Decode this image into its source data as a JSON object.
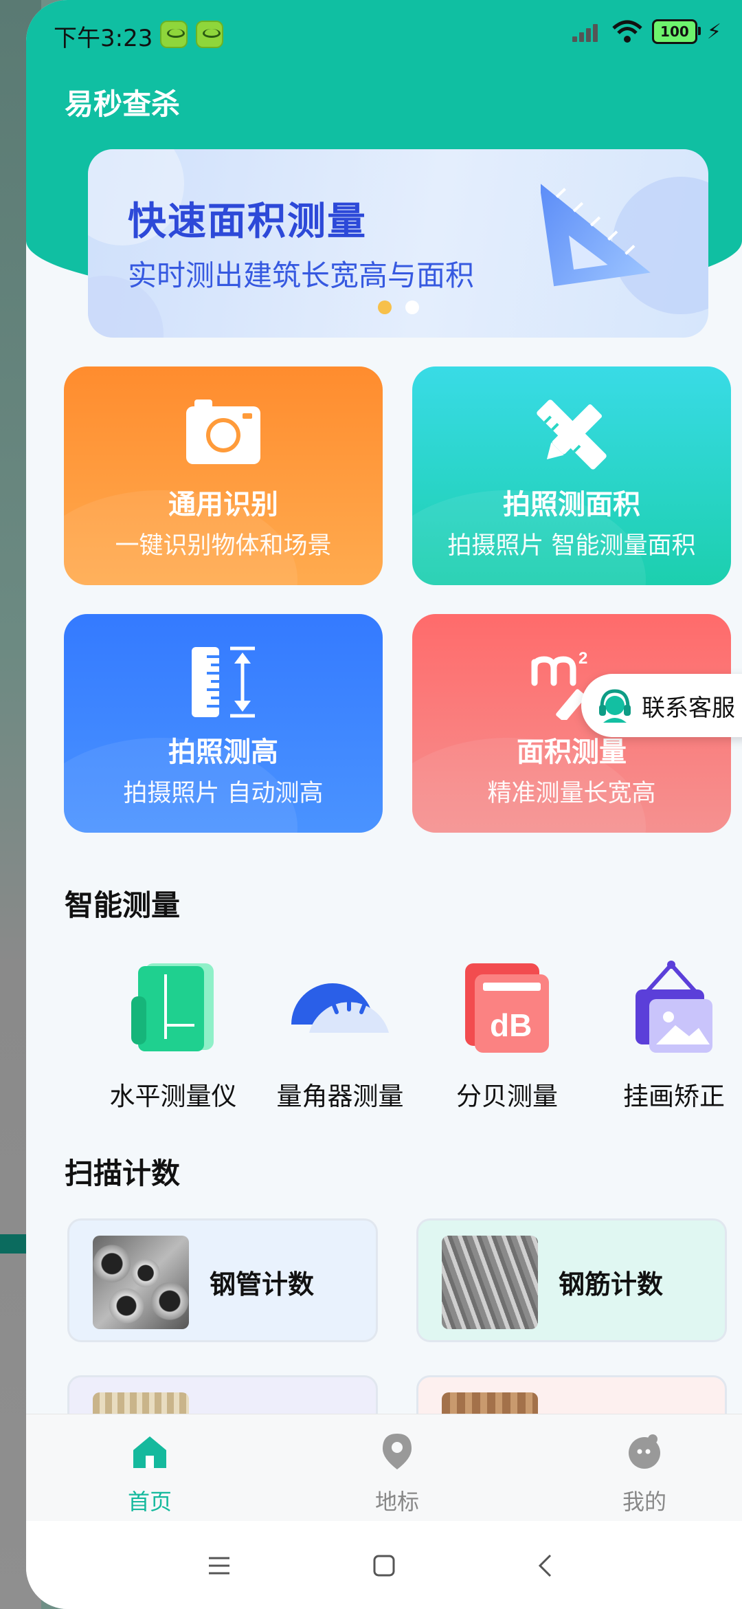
{
  "status_bar": {
    "time": "下午3:23",
    "battery": "100"
  },
  "header": {
    "title": "易秒查杀"
  },
  "banner": {
    "title": "快速面积测量",
    "subtitle": "实时测出建筑长宽高与面积",
    "dots": 2,
    "active_dot": 0
  },
  "feature_cards": [
    {
      "title": "通用识别",
      "subtitle": "一键识别物体和场景",
      "icon": "camera-icon",
      "color": "#ff9a3c"
    },
    {
      "title": "拍照测面积",
      "subtitle": "拍摄照片 智能测量面积",
      "icon": "pencil-ruler-icon",
      "color": "#2ad6c4"
    },
    {
      "title": "拍照测高",
      "subtitle": "拍摄照片 自动测高",
      "icon": "height-ruler-icon",
      "color": "#3d86ff"
    },
    {
      "title": "面积测量",
      "subtitle": "精准测量长宽高",
      "icon": "square-meter-icon",
      "color": "#f87a78"
    }
  ],
  "customer_service": {
    "label": "联系客服"
  },
  "smart_section": {
    "title": "智能测量",
    "tools": [
      {
        "label": "水平测量仪",
        "icon": "level-icon"
      },
      {
        "label": "量角器测量",
        "icon": "protractor-icon"
      },
      {
        "label": "分贝测量",
        "icon": "decibel-icon"
      },
      {
        "label": "挂画矫正",
        "icon": "picture-frame-icon"
      }
    ]
  },
  "scan_section": {
    "title": "扫描计数",
    "items": [
      {
        "label": "钢管计数"
      },
      {
        "label": "钢筋计数"
      },
      {
        "label": ""
      },
      {
        "label": ""
      }
    ]
  },
  "tabbar": {
    "tabs": [
      {
        "label": "首页",
        "icon": "home-icon",
        "active": true
      },
      {
        "label": "地标",
        "icon": "location-pin-icon",
        "active": false
      },
      {
        "label": "我的",
        "icon": "profile-face-icon",
        "active": false
      }
    ]
  },
  "colors": {
    "accent": "#10bfa2",
    "tab_active": "#15b99d"
  }
}
